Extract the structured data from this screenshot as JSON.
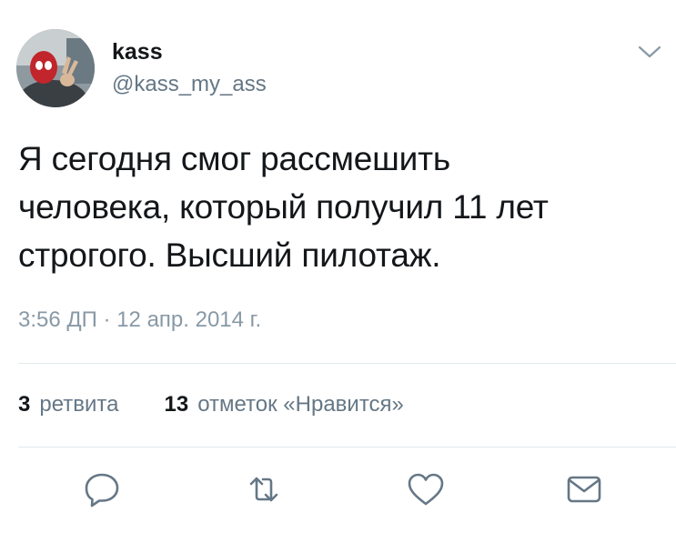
{
  "author": {
    "display_name": "kass",
    "handle": "@kass_my_ass"
  },
  "tweet": {
    "text": "Я сегодня смог рассмешить\nчеловека, который получил 11 лет\nстрогого. Высший пилотаж.",
    "timestamp": "3:56 ДП · 12 апр. 2014 г."
  },
  "stats": {
    "retweets_count": "3",
    "retweets_label": "ретвита",
    "likes_count": "13",
    "likes_label": "отметок «Нравится»"
  },
  "icons": {
    "menu": "chevron-down-icon",
    "reply": "reply-icon",
    "retweet": "retweet-icon",
    "like": "heart-icon",
    "message": "envelope-icon"
  },
  "colors": {
    "text_primary": "#14171a",
    "text_secondary": "#657786",
    "icon_gray": "#657786",
    "divider": "#e1e8ed"
  }
}
